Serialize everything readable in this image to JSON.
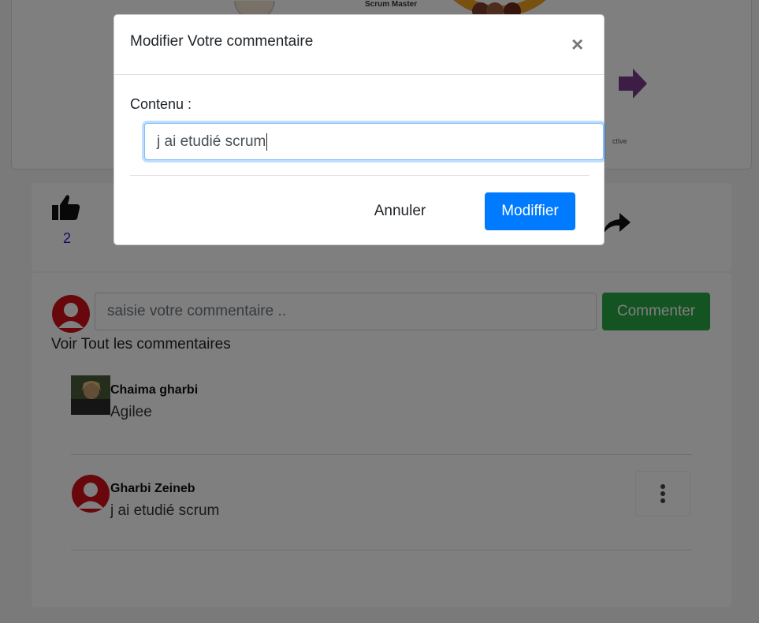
{
  "post": {
    "scrum_master_label": "Scrum Master",
    "retro_label": "ctive"
  },
  "actions": {
    "like_count": "2"
  },
  "comments": {
    "input_placeholder": "saisie votre commentaire ..",
    "submit_label": "Commenter",
    "see_all_label": "Voir Tout les commentaires",
    "items": [
      {
        "author": "Chaima gharbi",
        "text": "Agilee"
      },
      {
        "author": "Gharbi Zeineb",
        "text": "j ai etudié scrum"
      }
    ]
  },
  "modal": {
    "title": "Modifier Votre commentaire",
    "close_symbol": "×",
    "field_label": "Contenu :",
    "field_value": "j ai etudié scrum",
    "cancel_label": "Annuler",
    "submit_label": "Modiffier"
  },
  "colors": {
    "primary": "#007bff",
    "success": "#28a745",
    "avatar_red": "#d0101a"
  }
}
